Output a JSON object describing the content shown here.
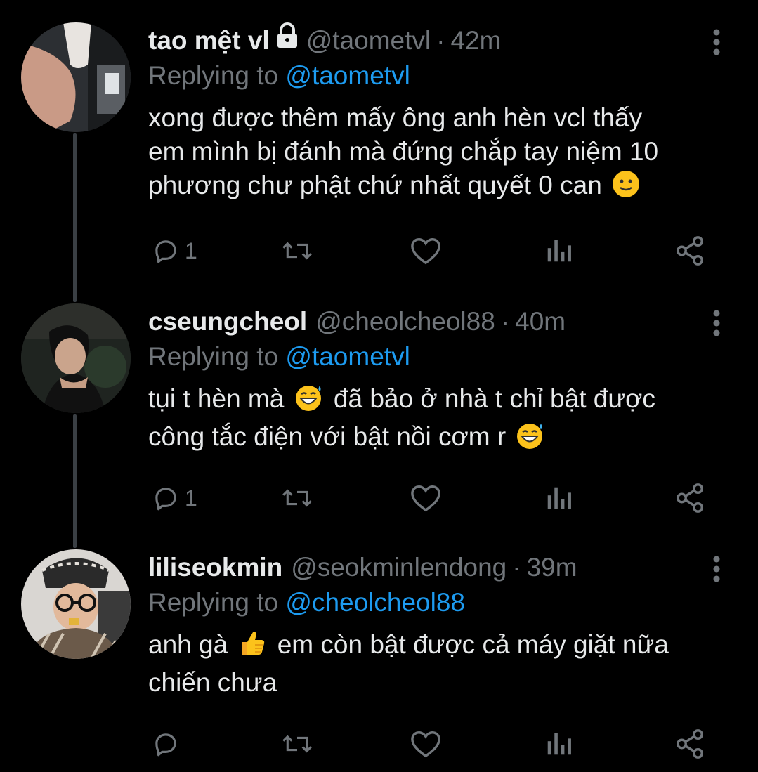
{
  "tweets": [
    {
      "display_name": "tao mệt vl",
      "locked": true,
      "handle": "@taometvl",
      "separator": "·",
      "time": "42m",
      "replying_prefix": "Replying to",
      "replying_to": "@taometvl",
      "text_lines": [
        "xong được thêm mấy ông anh hèn vcl thấy",
        "em mình bị đánh mà đứng chắp tay niệm 10",
        "phương chư phật chứ nhất quyết 0 can"
      ],
      "reply_count": "1",
      "avatar_icon": "avatar-photo-arm"
    },
    {
      "display_name": "cseungcheol",
      "locked": false,
      "handle": "@cheolcheol88",
      "separator": "·",
      "time": "40m",
      "replying_prefix": "Replying to",
      "replying_to": "@taometvl",
      "text_lines_a": [
        "tụi t hèn mà",
        "đã bảo ở nhà t chỉ bật được"
      ],
      "text_line_b": "công tắc điện với bật nồi cơm r",
      "reply_count": "1",
      "avatar_icon": "avatar-photo-man-night"
    },
    {
      "display_name": "liliseokmin",
      "locked": false,
      "handle": "@seokminlendong",
      "separator": "·",
      "time": "39m",
      "replying_prefix": "Replying to",
      "replying_to": "@cheolcheol88",
      "text_a": "anh gà",
      "text_b": "em còn bật được cả máy giặt nữa",
      "text_c": "chiến chưa",
      "reply_count": "",
      "avatar_icon": "avatar-photo-glasses-hat"
    }
  ],
  "icons": {
    "reply": "reply-icon",
    "retweet": "retweet-icon",
    "like": "like-icon",
    "views": "views-icon",
    "share": "share-icon",
    "more": "more-icon",
    "lock": "lock-icon"
  },
  "colors": {
    "background": "#000000",
    "text": "#e7e9ea",
    "muted": "#71767b",
    "mention": "#1d9bf0",
    "thread_line": "#3a3f44"
  }
}
